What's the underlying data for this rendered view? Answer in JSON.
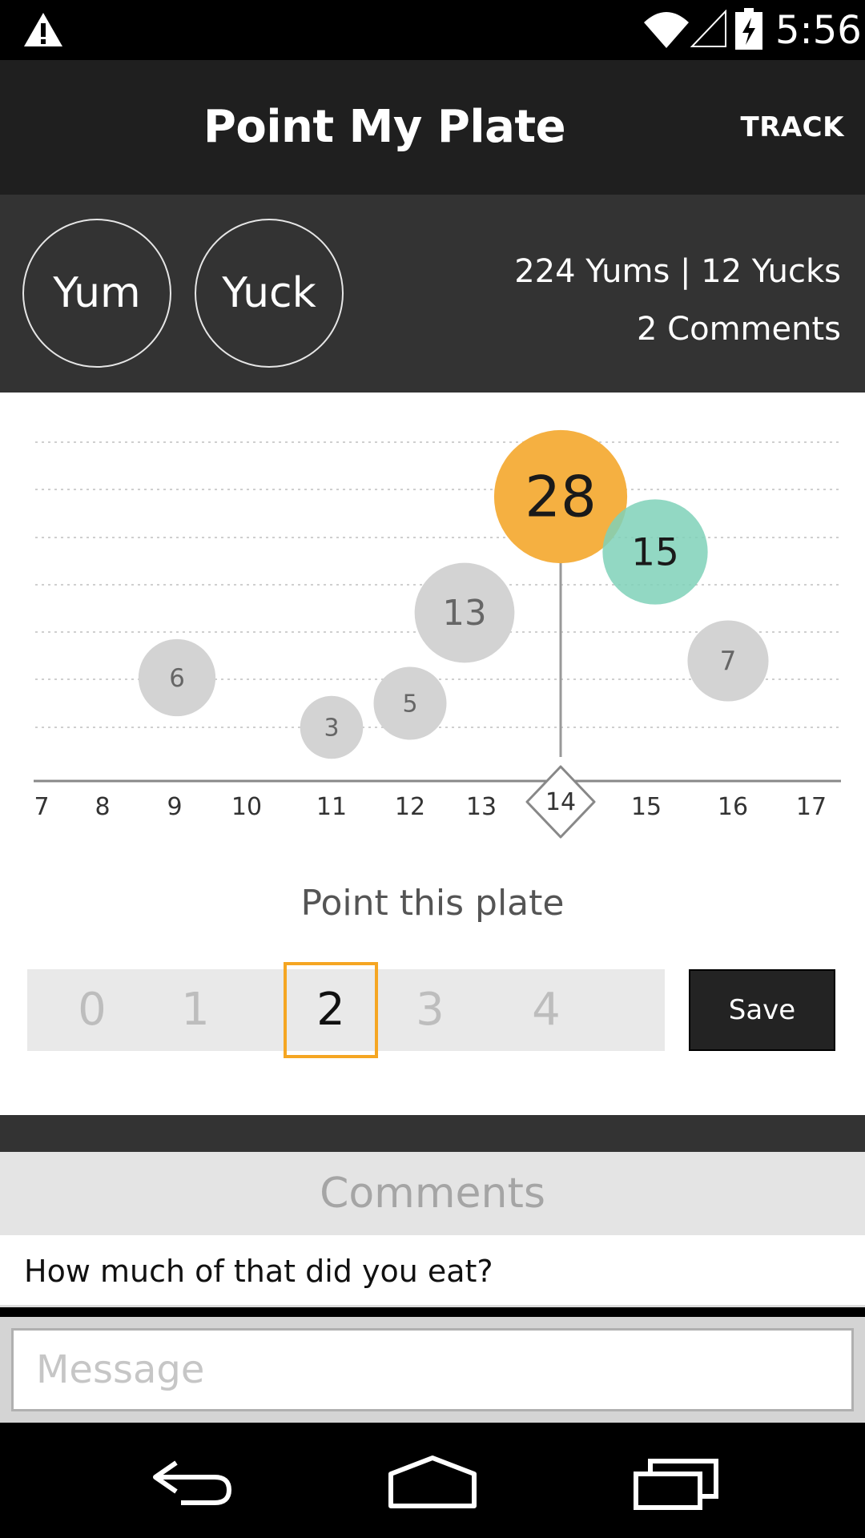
{
  "status_bar": {
    "time": "5:56",
    "icons": [
      "warning-icon",
      "wifi-icon",
      "signal-icon",
      "battery-charging-icon"
    ]
  },
  "app_bar": {
    "title": "Point My Plate",
    "action": "TRACK"
  },
  "rating": {
    "yum_label": "Yum",
    "yuck_label": "Yuck",
    "summary": "224 Yums | 12 Yucks",
    "comments_count": "2 Comments"
  },
  "chart_data": {
    "type": "scatter",
    "xlim": [
      7,
      17
    ],
    "x_ticks": [
      7,
      8,
      9,
      10,
      11,
      12,
      13,
      14,
      15,
      16,
      17
    ],
    "selected_x": 14,
    "points": [
      {
        "x": 9,
        "value": 6,
        "color": "#d3d3d3"
      },
      {
        "x": 11,
        "value": 3,
        "color": "#d3d3d3"
      },
      {
        "x": 12,
        "value": 5,
        "color": "#d3d3d3"
      },
      {
        "x": 13,
        "value": 13,
        "color": "#d3d3d3"
      },
      {
        "x": 14,
        "value": 28,
        "color": "#f5b041"
      },
      {
        "x": 15,
        "value": 15,
        "color": "#7fd1b9"
      },
      {
        "x": 16,
        "value": 7,
        "color": "#d3d3d3"
      }
    ],
    "grid": true
  },
  "point_picker": {
    "label": "Point this plate",
    "options": [
      "0",
      "1",
      "2",
      "3",
      "4"
    ],
    "selected": "2",
    "save_label": "Save",
    "accent": "#f5a623"
  },
  "comments": {
    "header": "Comments",
    "items": [
      "How much of that did you eat?"
    ],
    "message_placeholder": "Message"
  },
  "nav_bar": {
    "buttons": [
      "back-icon",
      "home-icon",
      "recents-icon"
    ]
  }
}
